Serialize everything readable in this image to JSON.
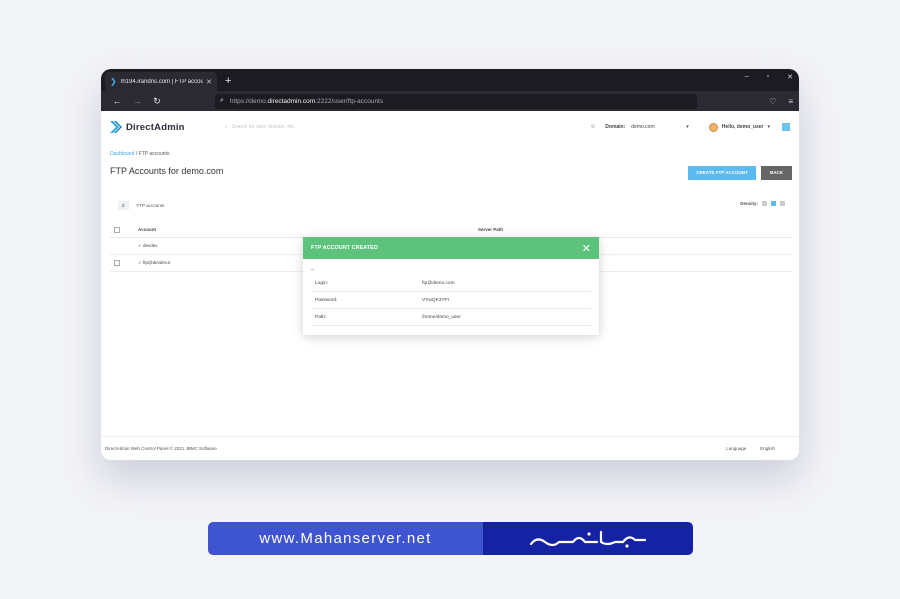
{
  "browser": {
    "tab_title": "lh194.irandns.com | FTP accoun",
    "tab_close": "✕",
    "new_tab": "+",
    "url_prefix": "https://demo.",
    "url_domain": "directadmin.com",
    "url_suffix": ":2222/user/ftp-accounts",
    "controls": {
      "minimize": "–",
      "maximize": "▫",
      "close": "✕"
    }
  },
  "header": {
    "logo_text": "DirectAdmin",
    "search_placeholder": "Search for user, domain, etc.",
    "domain_label": "Domain:",
    "domain_value": "demo.com",
    "greeting": "Hello, demo_user"
  },
  "breadcrumb": {
    "root": "Dashboard",
    "sep": " / ",
    "current": "FTP accounts"
  },
  "page": {
    "title": "FTP Accounts for demo.com",
    "create_button": "CREATE FTP ACCOUNT",
    "back_button": "BACK",
    "count": "2",
    "count_label": "FTP accounts",
    "density_label": "Density:"
  },
  "table": {
    "columns": [
      "Account",
      "Server Path"
    ],
    "rows": [
      {
        "account": "✓ devdev",
        "path": ""
      },
      {
        "account": "✓ ftp@devdev.ir",
        "path": ""
      }
    ]
  },
  "modal": {
    "title": "FTP ACCOUNT CREATED",
    "close": "✕",
    "dash": "–",
    "fields": [
      {
        "key": "Login:",
        "value": "ftp@demo.com"
      },
      {
        "key": "Password:",
        "value": "VYwQK3TPI"
      },
      {
        "key": "Path:",
        "value": "/home/demo_user"
      }
    ]
  },
  "footer": {
    "copyright": "DirectAdmin Web Control Panel © 2021 JBMC Software",
    "language_label": "Language",
    "language_value": "English"
  },
  "banner": {
    "url": "www.Mahanserver.net"
  },
  "colors": {
    "accent": "#5bbaf0",
    "modal_header": "#5dc27b",
    "banner_left": "#3f54d1",
    "banner_right": "#1522a3"
  }
}
